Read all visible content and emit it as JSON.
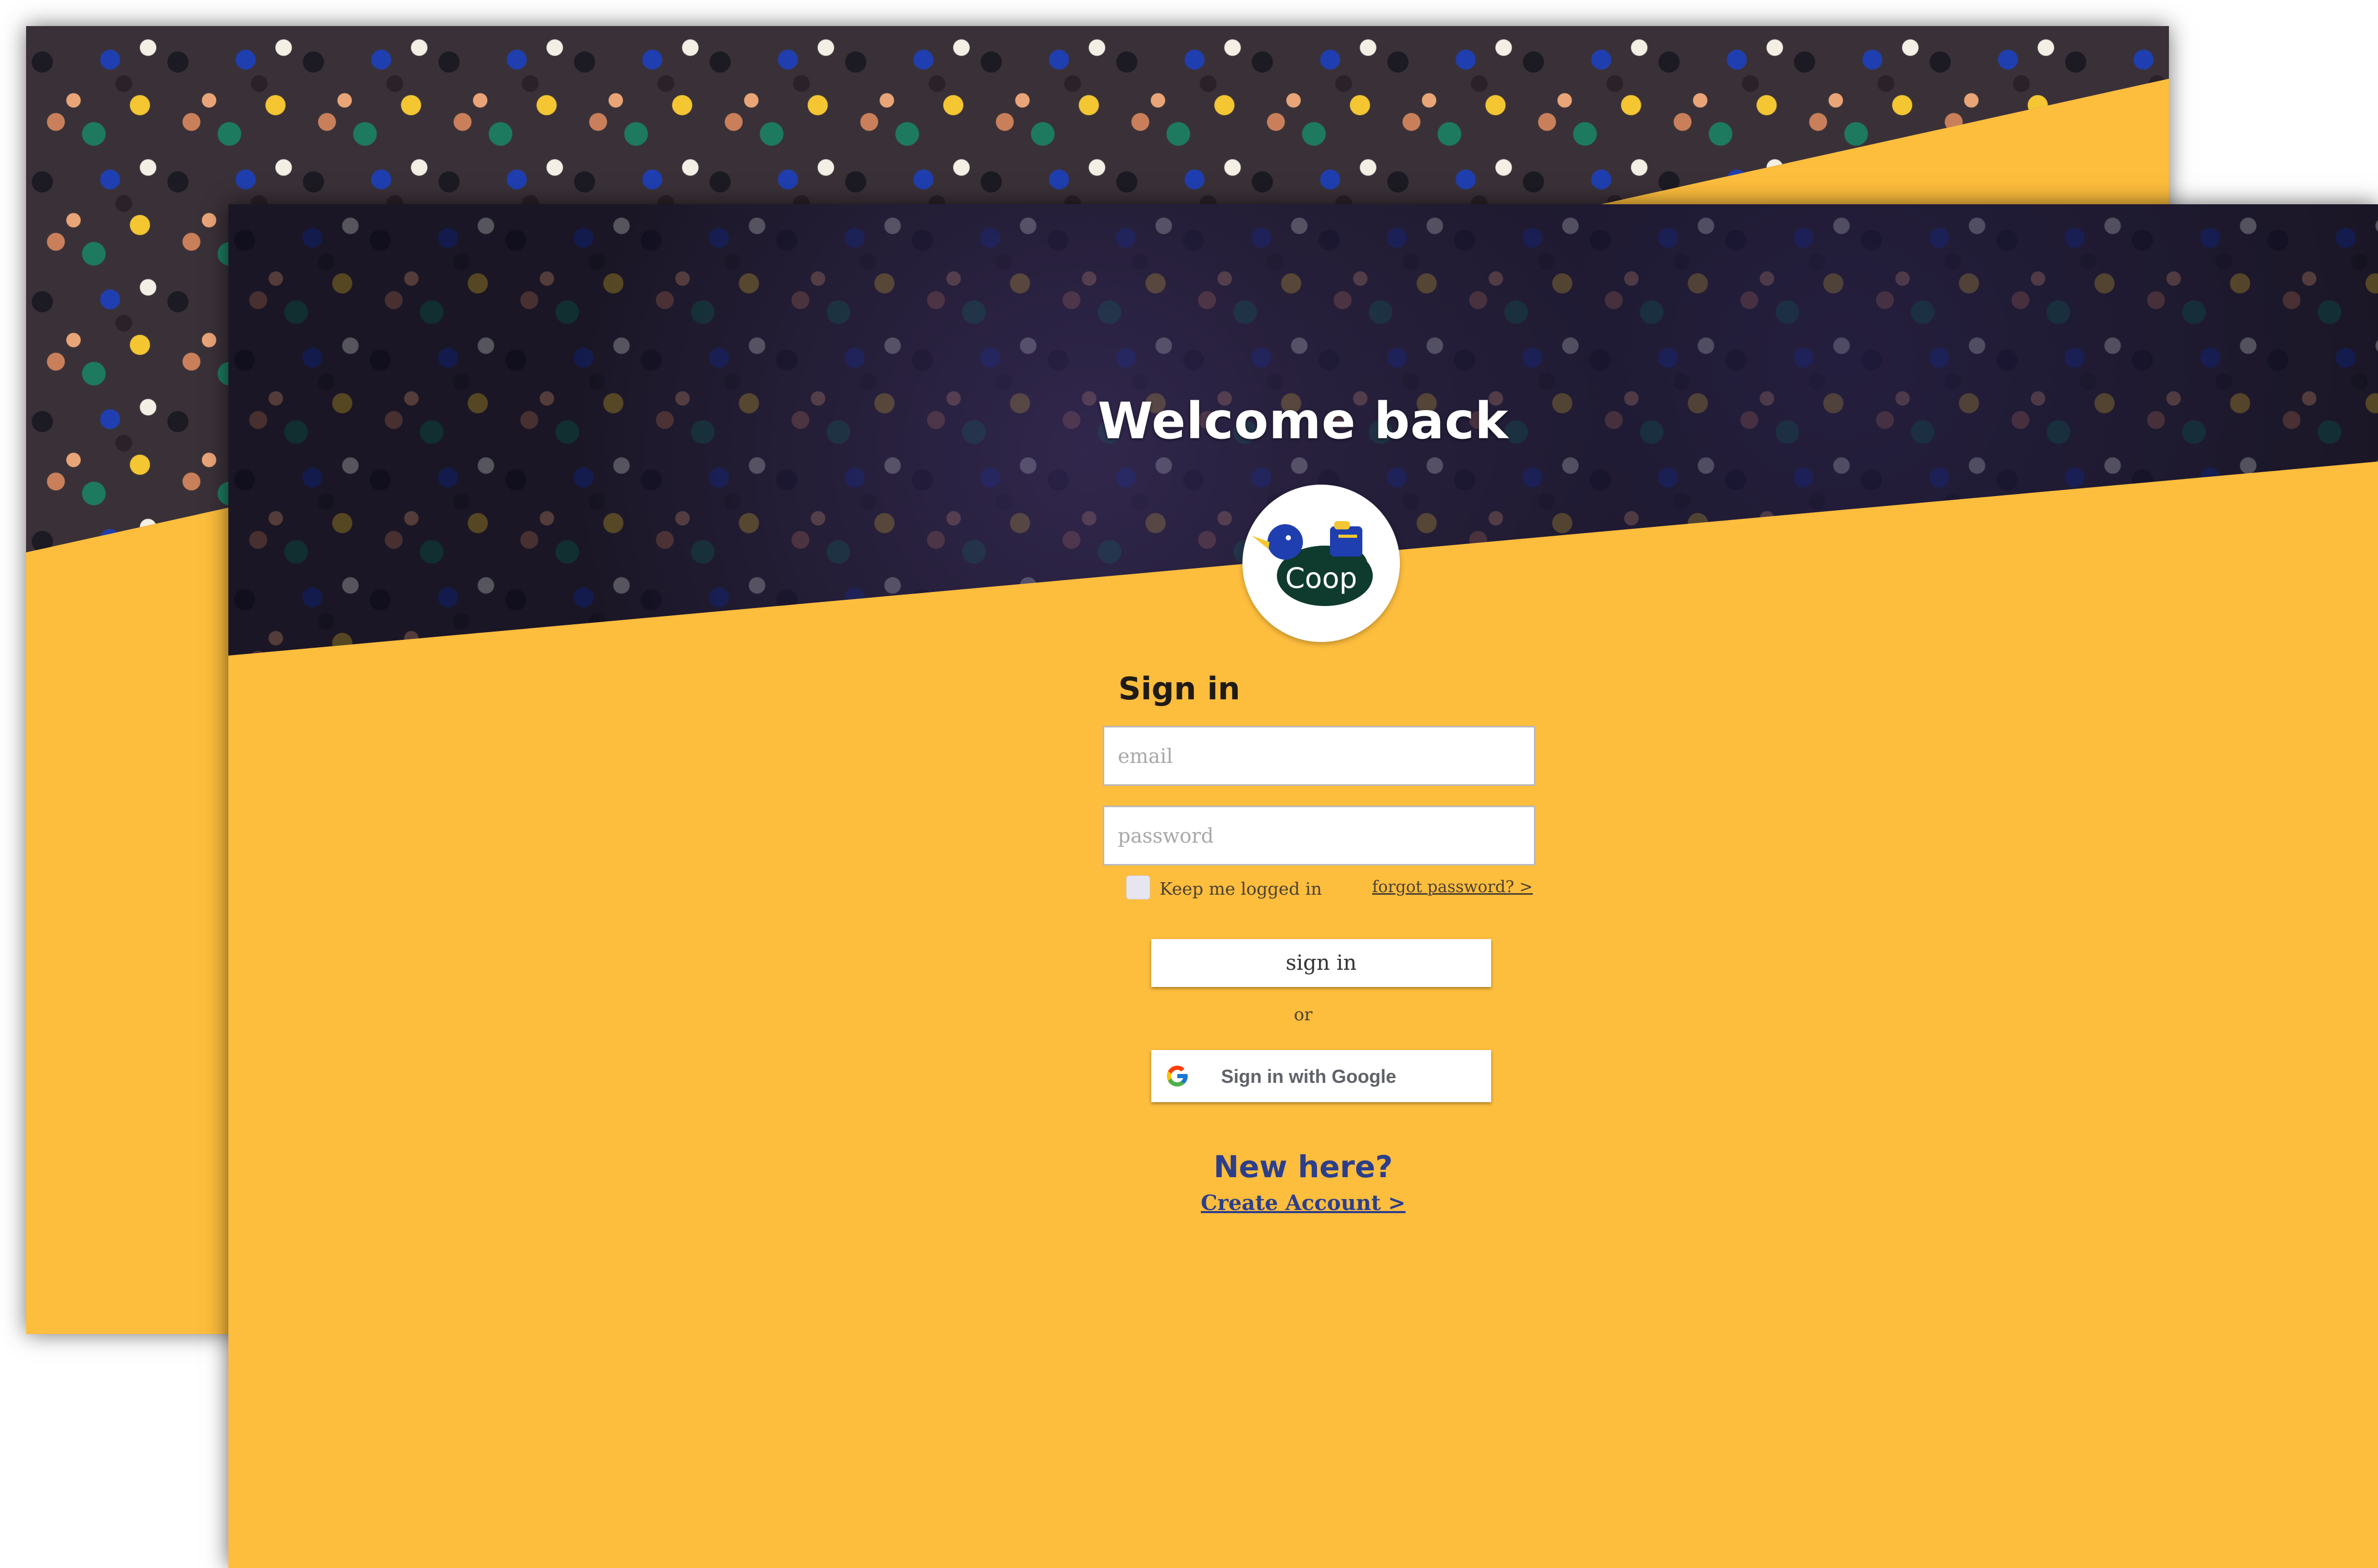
{
  "hero": {
    "title": "Welcome back"
  },
  "logo": {
    "text": "Coop"
  },
  "form": {
    "title": "Sign in",
    "email_placeholder": "email",
    "password_placeholder": "password",
    "remember_label": "Keep me logged in",
    "forgot_link": "forgot password? >",
    "signin_button": "sign in",
    "or_text": "or",
    "google_button": "Sign in with Google"
  },
  "signup": {
    "prompt": "New here?",
    "link": "Create Account >"
  },
  "icons": {
    "logo": "coop-duck-logo-icon",
    "google": "google-g-icon"
  },
  "colors": {
    "background_yellow": "#fdbd3d",
    "heading_blue": "#2c3f8c",
    "logo_green": "#0f3b2e",
    "logo_blue": "#1f3fb0"
  }
}
